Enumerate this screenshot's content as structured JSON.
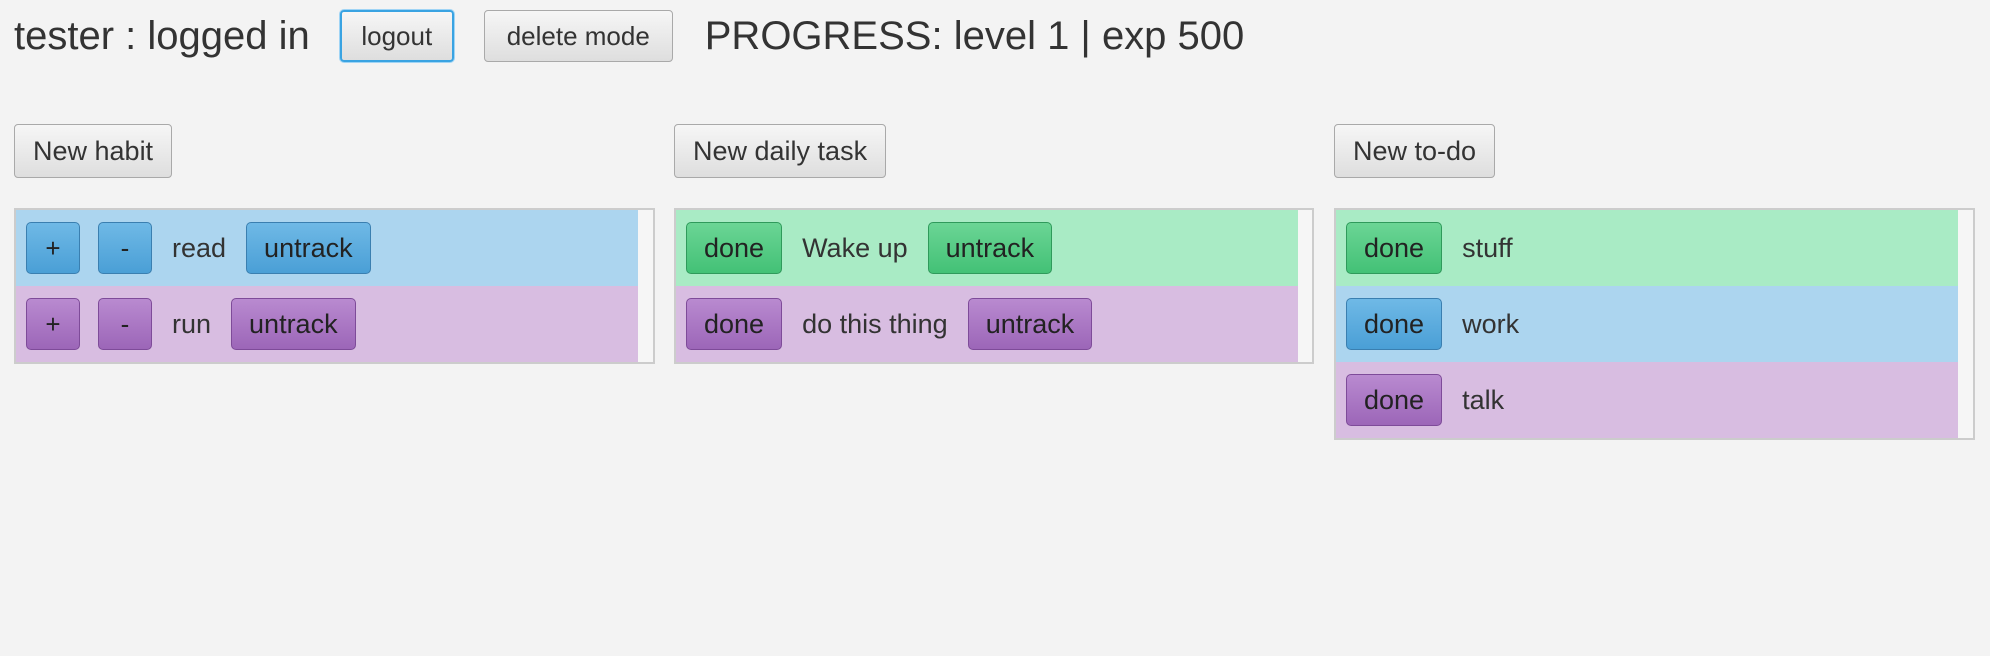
{
  "header": {
    "status": "tester : logged in",
    "logout_label": "logout",
    "delete_mode_label": "delete mode",
    "progress": "PROGRESS: level 1 | exp 500"
  },
  "columns": {
    "habits": {
      "new_label": "New habit",
      "items": [
        {
          "plus": "+",
          "minus": "-",
          "name": "read",
          "untrack": "untrack",
          "color": "blue"
        },
        {
          "plus": "+",
          "minus": "-",
          "name": "run",
          "untrack": "untrack",
          "color": "purple"
        }
      ]
    },
    "daily": {
      "new_label": "New daily task",
      "items": [
        {
          "done": "done",
          "name": "Wake up",
          "untrack": "untrack",
          "color": "green"
        },
        {
          "done": "done",
          "name": "do this thing",
          "untrack": "untrack",
          "color": "purple"
        }
      ]
    },
    "todos": {
      "new_label": "New to-do",
      "items": [
        {
          "done": "done",
          "name": "stuff",
          "color": "green"
        },
        {
          "done": "done",
          "name": "work",
          "color": "blue"
        },
        {
          "done": "done",
          "name": "talk",
          "color": "purple"
        }
      ]
    }
  },
  "colors": {
    "row_blue": "#acd5ef",
    "row_purple": "#d8bde1",
    "row_green": "#a9ebc5",
    "focus_ring": "#39a3e2"
  }
}
